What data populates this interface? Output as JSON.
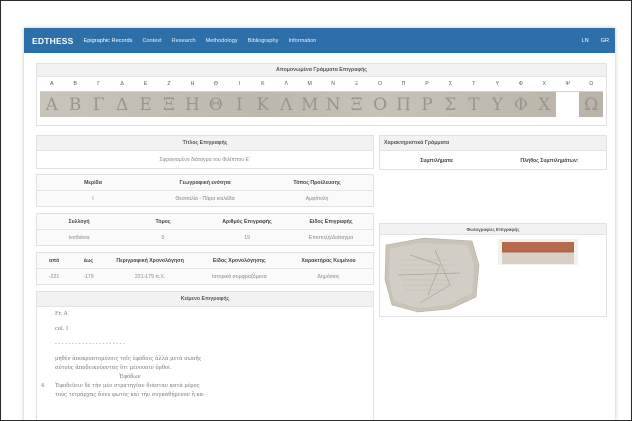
{
  "nav": {
    "brand": "EDTHESS",
    "items": [
      "Epigraphic Records",
      "Context",
      "Research",
      "Methodology",
      "Bibliography",
      "Information"
    ],
    "right": [
      "LN",
      "GR"
    ]
  },
  "alphabet": {
    "title": "Απομονωμένα Γράμματα Επιγραφής",
    "letters": [
      "Α",
      "Β",
      "Γ",
      "Δ",
      "Ε",
      "Ζ",
      "Η",
      "Θ",
      "Ι",
      "Κ",
      "Λ",
      "Μ",
      "Ν",
      "Ξ",
      "Ο",
      "Π",
      "Ρ",
      "Σ",
      "Τ",
      "Υ",
      "Φ",
      "Χ",
      "Ψ",
      "Ω"
    ],
    "glyphs": [
      "Α",
      "Β",
      "Γ",
      "Δ",
      "Ε",
      "Ξ",
      "Η",
      "Θ",
      "Ι",
      "Κ",
      "Λ",
      "Μ",
      "Ν",
      "Ξ",
      "Ο",
      "Π",
      "Ρ",
      "Σ",
      "Τ",
      "Υ",
      "Φ",
      "Χ",
      "",
      "Ω"
    ]
  },
  "title_panel": {
    "heading": "Τίτλος Επιγραφής",
    "value": "Σφραγισμένο διάταγμα του Φιλίππου Ε΄"
  },
  "location": {
    "headers": [
      "Μερίδα",
      "Γεωγραφική ενότητα",
      "Τόπος Προέλευσης"
    ],
    "values": [
      "I",
      "Θεσσαλία - Πάρα κοιλάδα",
      "Αμφίπολη"
    ]
  },
  "collection": {
    "headers": [
      "Συλλογή",
      "Τόμος",
      "Αριθμός Επιγραφής",
      "Είδος Επιγραφής"
    ],
    "values": [
      "Ινσθιάνια",
      "5",
      "19",
      "Επιστολή/Διάταγμα"
    ]
  },
  "dating": {
    "headers": [
      "από",
      "έως",
      "Περιγραφική Χρονολόγηση",
      "Είδος Χρονολόγησης",
      "Χαρακτήρας Κειμένου"
    ],
    "values": [
      "-221",
      "-179",
      "221-179 π.Χ.",
      "Ιστορικά συμφραζόμενα",
      "Δημόσιος"
    ]
  },
  "text_panel": {
    "heading": "Κείμενο Επιγραφής",
    "lines": [
      {
        "num": "",
        "text": "Fr. A"
      },
      {
        "num": "",
        "text": "col. I"
      },
      {
        "num": "",
        "text": "- - - - - - - - - - - - - - - - - - - - -"
      },
      {
        "num": "",
        "text": "μηθὲν ἀποκρυπτομένοις τοῖς ἐφόδοις ἀλλὰ μετὰ σωπῆς"
      },
      {
        "num": "",
        "text": "αὐτοὺς ἀποδεικνύοντας ὅτι μένουσιν ὀρθοί."
      },
      {
        "num": "",
        "text": "Ἐφόδων"
      },
      {
        "num": "4",
        "text": "Ἐφοδεῦειν δὲ τὴν μὲν στρατηγίαν διάσταν κατὰ μέρος"
      },
      {
        "num": "",
        "text": "τοὺς τετράρχας ἄνευ φωτὸς καὶ τὴν συγκαθήμενον ἢ κα-"
      }
    ]
  },
  "chars_panel": {
    "heading": "Χαρακτηριστικά Γράμματα",
    "col1": "Συμπιλήματα",
    "col2": "Πλήθος Συμπιλημάτων:"
  },
  "photo_panel": {
    "heading": "Φωτογραφίες Επιγραφής"
  },
  "colors": {
    "navbar": "#2d6fa8",
    "panel_head": "#f2f2f2"
  }
}
